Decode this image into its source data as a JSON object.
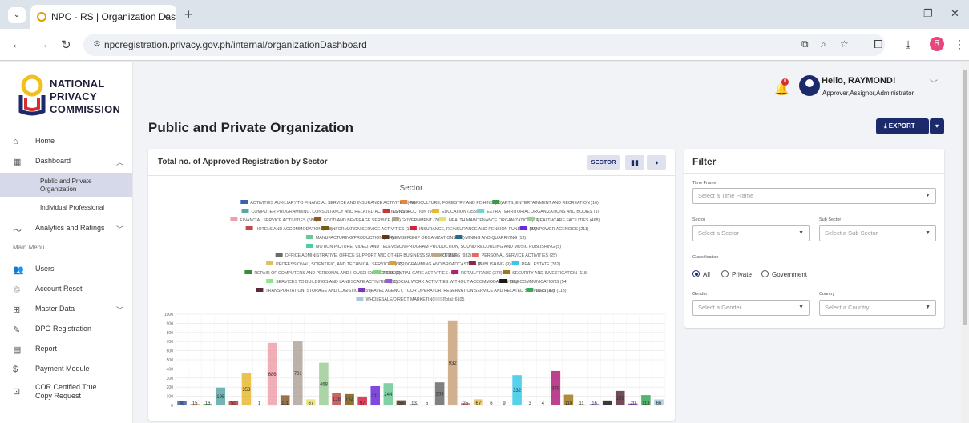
{
  "browser": {
    "tab_title": "NPC - RS | Organization Dashb",
    "url": "npcregistration.privacy.gov.ph/internal/organizationDashboard",
    "profile_initial": "R"
  },
  "sidebar": {
    "logo_text": [
      "NATIONAL",
      "PRIVACY",
      "COMMISSION"
    ],
    "main_menu_label": "Main Menu",
    "items": [
      {
        "label": "Home",
        "icon": "home-icon"
      },
      {
        "label": "Dashboard",
        "icon": "dashboard-icon"
      },
      {
        "label": "Public and Private Organization"
      },
      {
        "label": "Individual Professional"
      },
      {
        "label": "Analytics and Ratings",
        "icon": "trending-icon"
      },
      {
        "label": "Users",
        "icon": "users-icon"
      },
      {
        "label": "Account Reset",
        "icon": "account-reset-icon"
      },
      {
        "label": "Master Data",
        "icon": "sitemap-icon"
      },
      {
        "label": "DPO Registration",
        "icon": "pen-icon"
      },
      {
        "label": "Report",
        "icon": "report-icon"
      },
      {
        "label": "Payment Module",
        "icon": "dollar-icon"
      },
      {
        "label": "COR Certified True Copy Request",
        "icon": "id-card-icon"
      }
    ]
  },
  "header": {
    "greeting": "Hello, RAYMOND!",
    "roles": "Approver,Assignor,Administrator",
    "notification_count": "0"
  },
  "page": {
    "title": "Public and Private Organization",
    "export_label": "EXPORT"
  },
  "chart_card": {
    "title": "Total no. of Approved Registration by Sector",
    "sector_button": "SECTOR"
  },
  "filter": {
    "title": "Filter",
    "time_frame_label": "Time Frame",
    "time_frame_placeholder": "Select a Time Frame",
    "sector_label": "Sector",
    "sector_placeholder": "Select a Sector",
    "sub_sector_label": "Sub Sector",
    "sub_sector_placeholder": "Select a Sub Sector",
    "classification_label": "Classification",
    "classification_options": [
      "All",
      "Private",
      "Government"
    ],
    "classification_selected": "All",
    "gender_label": "Gender",
    "gender_placeholder": "Select a Gender",
    "country_label": "Country",
    "country_placeholder": "Select a Country"
  },
  "chart_data": {
    "type": "bar",
    "title": "Sector",
    "ylim": [
      0,
      1000
    ],
    "yticks": [
      0,
      100,
      200,
      300,
      400,
      500,
      600,
      700,
      800,
      900,
      1000
    ],
    "grid": true,
    "legend_placement": "top",
    "total_label": "Total: 6105",
    "series": [
      {
        "name": "ACTIVITIES AUXILIARY TO FINANCIAL SERVICE AND INSURANCE ACTIVITIES",
        "value": 49,
        "color": "#3f5fa8"
      },
      {
        "name": "AGRICULTURE, FORESTRY AND FISHING",
        "value": 15,
        "color": "#e9853a"
      },
      {
        "name": "ARTS, ENTERTAINMENT AND RECREATION",
        "value": 16,
        "color": "#3a9a4a"
      },
      {
        "name": "COMPUTER PROGRAMMING, CONSULTANCY AND RELATED ACTIVITIES",
        "value": 195,
        "color": "#5aa6a6"
      },
      {
        "name": "CONSTRUCTION",
        "value": 50,
        "color": "#c03a3a"
      },
      {
        "name": "EDUCATION",
        "value": 353,
        "color": "#e8b933"
      },
      {
        "name": "EXTRA TERRITORIAL ORGANIZATIONS AND BODIES",
        "value": 1,
        "color": "#6fd4d4"
      },
      {
        "name": "FINANCIAL SERVICE ACTIVITIES",
        "value": 686,
        "color": "#f0a0aa"
      },
      {
        "name": "FOOD AND BEVERAGE SERVICE",
        "value": 111,
        "color": "#8a5a2a"
      },
      {
        "name": "GOVERNMENT",
        "value": 701,
        "color": "#b0a59a"
      },
      {
        "name": "HEALTH MAINTENANCE ORGANIZATION",
        "value": 67,
        "color": "#e8e070"
      },
      {
        "name": "HEALTHCARE FACILITIES",
        "value": 468,
        "color": "#9dcc96"
      },
      {
        "name": "HOTELS AND ACCOMMODATION",
        "value": 138,
        "color": "#c04a4a"
      },
      {
        "name": "INFORMATION SERVICE ACTIVITIES",
        "value": 124,
        "color": "#7a5a10"
      },
      {
        "name": "INSURANCE, REINSURANCE AND PENSION FUNDING",
        "value": 97,
        "color": "#d8203a"
      },
      {
        "name": "MANPOWER AGENCIES",
        "value": 211,
        "color": "#6a2ad8"
      },
      {
        "name": "MANUFACTURING/PRODUCTION",
        "value": 244,
        "color": "#6cc896"
      },
      {
        "name": "MEMBERSHIP ORGANIZATIONS",
        "value": 56,
        "color": "#5a3a1a"
      },
      {
        "name": "MINING AND QUARRYING",
        "value": 13,
        "color": "#2a6a8a"
      },
      {
        "name": "MOTION PICTURE, VIDEO, AND TELEVISION PROGRAM PRODUCTION, SOUND RECORDING AND MUSIC PUBLISHING",
        "value": 5,
        "color": "#4ad0a0"
      },
      {
        "name": "OFFICE ADMINISTRATIVE, OFFICE SUPPORT AND OTHER BUSINESS SUPPORT",
        "value": 253,
        "color": "#6a6a6a"
      },
      {
        "name": "OTHERS",
        "value": 932,
        "color": "#c8a27a"
      },
      {
        "name": "PERSONAL SERVICE ACTIVITIES",
        "value": 25,
        "color": "#e86a5a"
      },
      {
        "name": "PROFESSIONAL, SCIENTIFIC, AND TECHNICAL SERVICES",
        "value": 67,
        "color": "#e0c060"
      },
      {
        "name": "PROGRAMMING AND BROADCASTING",
        "value": 6,
        "color": "#d8a040"
      },
      {
        "name": "PUBLISHING",
        "value": 9,
        "color": "#8a2a4a"
      },
      {
        "name": "REAL ESTATE",
        "value": 332,
        "color": "#3ac8e8"
      },
      {
        "name": "REPAIR OF COMPUTERS AND PERSONAL AND HOUSEHOLD GOODS",
        "value": 3,
        "color": "#3a8a3a"
      },
      {
        "name": "RESIDENTIAL CARE ACTIVITIES",
        "value": 4,
        "color": "#7ad87a"
      },
      {
        "name": "RETAIL/TRADE",
        "value": 378,
        "color": "#b0207a"
      },
      {
        "name": "SECURITY AND INVESTIGATION",
        "value": 118,
        "color": "#a07a1a"
      },
      {
        "name": "SERVICES TO BUILDINGS AND LANDSCAPE ACTIVITIES",
        "value": 11,
        "color": "#8ae88a"
      },
      {
        "name": "SOCIAL WORK ACTIVITIES WITHOUT ACCOMMODATION",
        "value": 16,
        "color": "#9a5ad8"
      },
      {
        "name": "TELECOMMUNICATIONS",
        "value": 54,
        "color": "#1a1a1a"
      },
      {
        "name": "TRANSPORTATION, STORAGE AND LOGISTICS",
        "value": 159,
        "color": "#5a2a3a"
      },
      {
        "name": "TRAVEL AGENCY, TOUR OPERATOR, RESERVATION SERVICE AND RELATED SERVICES",
        "value": 20,
        "color": "#7a3ab8"
      },
      {
        "name": "UTILITIES",
        "value": 113,
        "color": "#3aa85a"
      },
      {
        "name": "WHOLESALE/DIRECT MARKETING",
        "value": 66,
        "color": "#a8c8d8"
      }
    ],
    "total_color": "#d8d8d8"
  }
}
